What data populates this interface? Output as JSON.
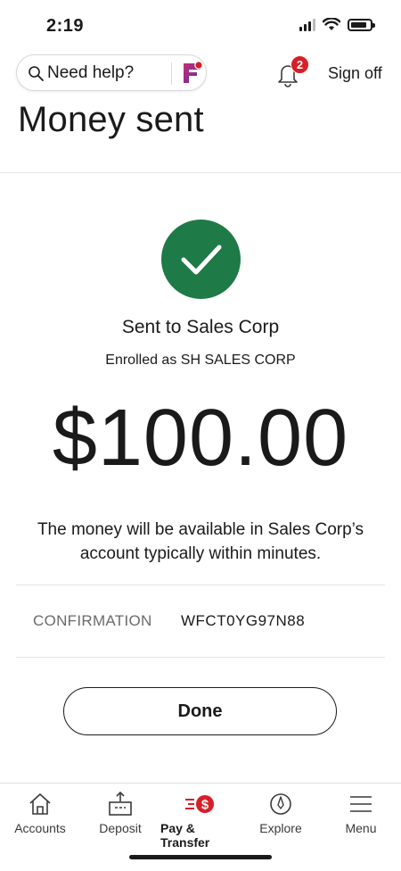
{
  "status_bar": {
    "time": "2:19"
  },
  "header": {
    "help_text": "Need help?",
    "notification_count": "2",
    "signoff_label": "Sign off"
  },
  "page": {
    "title": "Money sent"
  },
  "confirmation_card": {
    "sent_to": "Sent to Sales Corp",
    "enrolled_as": "Enrolled as SH SALES CORP",
    "amount": "$100.00",
    "message": "The money will be available in Sales Corp’s account typically within minutes.",
    "confirmation_label": "CONFIRMATION",
    "confirmation_number": "WFCT0YG97N88",
    "done_label": "Done"
  },
  "bottom_nav": {
    "items": [
      {
        "label": "Accounts",
        "icon": "home-icon"
      },
      {
        "label": "Deposit",
        "icon": "deposit-icon"
      },
      {
        "label": "Pay & Transfer",
        "icon": "pay-transfer-icon",
        "active": true
      },
      {
        "label": "Explore",
        "icon": "compass-icon"
      },
      {
        "label": "Menu",
        "icon": "hamburger-icon"
      }
    ]
  },
  "colors": {
    "success_green": "#1e7a46",
    "brand_red": "#d71e28",
    "fargo_purple": "#8a2a8a"
  }
}
